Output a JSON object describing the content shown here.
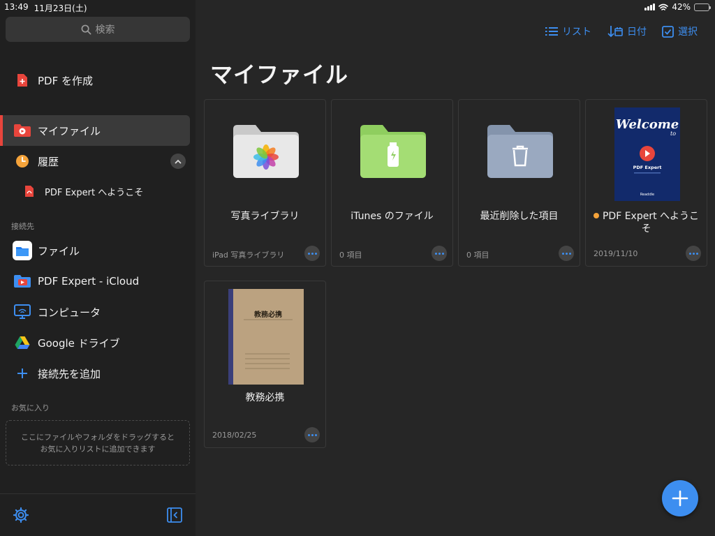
{
  "status": {
    "time": "13:49",
    "date": "11月23日(土)",
    "battery": "42%",
    "battery_level": 0.42
  },
  "sidebar": {
    "search_placeholder": "検索",
    "create_pdf": "PDF を作成",
    "my_files": "マイファイル",
    "history": "履歴",
    "history_item": "PDF Expert へようこそ",
    "connections_label": "接続先",
    "connections": [
      {
        "label": "ファイル",
        "icon": "files-app-icon"
      },
      {
        "label": "PDF Expert - iCloud",
        "icon": "icloud-icon"
      },
      {
        "label": "コンピュータ",
        "icon": "computer-icon"
      },
      {
        "label": "Google ドライブ",
        "icon": "google-drive-icon"
      },
      {
        "label": "接続先を追加",
        "icon": "plus-icon"
      }
    ],
    "favorites_label": "お気に入り",
    "favorites_hint": "ここにファイルやフォルダをドラッグすると\nお気に入りリストに追加できます"
  },
  "toolbar": {
    "list": "リスト",
    "date": "日付",
    "select": "選択"
  },
  "main": {
    "title": "マイファイル",
    "items": [
      {
        "name": "写真ライブラリ",
        "meta": "iPad 写真ライブラリ",
        "icon": "photos-folder-icon"
      },
      {
        "name": "iTunes のファイル",
        "meta": "0 項目",
        "icon": "itunes-folder-icon"
      },
      {
        "name": "最近削除した項目",
        "meta": "0 項目",
        "icon": "trash-folder-icon"
      },
      {
        "name": "PDF Expert へようこそ",
        "meta": "2019/11/10",
        "icon": "pdf-thumbnail"
      },
      {
        "name": "教務必携",
        "meta": "2018/02/25",
        "icon": "notebook-thumbnail"
      }
    ],
    "thumb_welcome": {
      "title": "Welcome",
      "to": "to",
      "brand": "PDF Expert",
      "footer": "Readdle"
    },
    "thumb_notebook": {
      "title": "教務必携"
    }
  },
  "colors": {
    "accent": "#3d8ef0",
    "brand_red": "#e8453c",
    "unread_dot": "#f5a33a"
  }
}
